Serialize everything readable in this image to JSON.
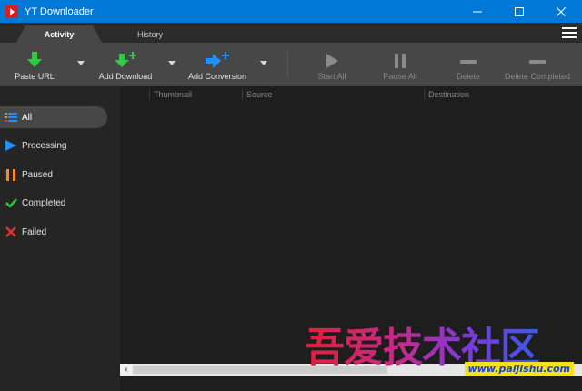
{
  "window": {
    "title": "YT Downloader",
    "controls": [
      "minimize",
      "maximize",
      "close"
    ]
  },
  "tabs": [
    {
      "label": "Activity",
      "active": true
    },
    {
      "label": "History",
      "active": false
    }
  ],
  "toolbar": {
    "paste_url": {
      "label": "Paste URL",
      "icon": "download-arrow-icon",
      "color": "#2ecc40"
    },
    "add_download": {
      "label": "Add Download",
      "icon": "download-plus-icon",
      "color": "#2ecc40"
    },
    "add_conversion": {
      "label": "Add Conversion",
      "icon": "convert-plus-icon",
      "color": "#1e90ff"
    },
    "start_all": {
      "label": "Start All",
      "icon": "play-icon",
      "enabled": false
    },
    "pause_all": {
      "label": "Pause All",
      "icon": "pause-icon",
      "enabled": false
    },
    "delete": {
      "label": "Delete",
      "icon": "minus-icon",
      "enabled": false
    },
    "delete_completed": {
      "label": "Delete Completed",
      "icon": "minus-icon",
      "enabled": false
    }
  },
  "sidebar": {
    "items": [
      {
        "label": "All",
        "icon": "list-icon",
        "selected": true
      },
      {
        "label": "Processing",
        "icon": "play-icon",
        "color": "#1e90ff"
      },
      {
        "label": "Paused",
        "icon": "pause-icon",
        "color": "#ff8c1a"
      },
      {
        "label": "Completed",
        "icon": "check-icon",
        "color": "#2ecc40"
      },
      {
        "label": "Failed",
        "icon": "x-icon",
        "color": "#e03030"
      }
    ]
  },
  "table": {
    "columns": [
      "Thumbnail",
      "Source",
      "Destination"
    ],
    "rows": []
  },
  "watermark": {
    "text": "吾爱技术社区",
    "url": "www.paijishu.com"
  }
}
